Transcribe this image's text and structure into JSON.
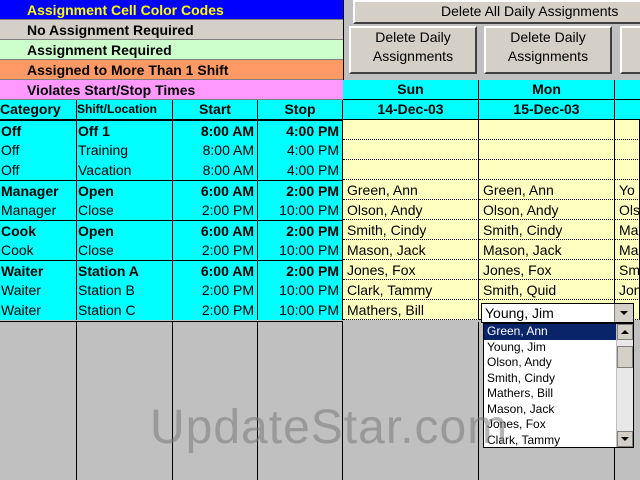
{
  "legend": {
    "title": "Assignment Cell Color Codes",
    "items": [
      {
        "label": "No Assignment Required",
        "color": "#d4d0c8"
      },
      {
        "label": "Assignment Required",
        "color": "#ccffcc"
      },
      {
        "label": "Assigned to More Than 1 Shift",
        "color": "#ff9966"
      },
      {
        "label": "Violates Start/Stop Times",
        "color": "#ff99ff"
      }
    ],
    "title_bg": "#0000ff",
    "title_color": "#ffff00"
  },
  "buttons": {
    "delete_all": "Delete All Daily Assignments",
    "delete_daily_line1": "Delete Daily",
    "delete_daily_line2": "Assignments"
  },
  "columns": {
    "category": "Category",
    "shift": "Shift/Location",
    "start": "Start",
    "stop": "Stop"
  },
  "days": [
    {
      "name": "Sun",
      "date": "14-Dec-03"
    },
    {
      "name": "Mon",
      "date": "15-Dec-03"
    }
  ],
  "rows": [
    {
      "category": "Off",
      "shift": "Off 1",
      "start": "8:00 AM",
      "stop": "4:00 PM",
      "bold": true,
      "sun": "",
      "mon": "",
      "tue": ""
    },
    {
      "category": "Off",
      "shift": "Training",
      "start": "8:00 AM",
      "stop": "4:00 PM",
      "bold": false,
      "sun": "",
      "mon": "",
      "tue": ""
    },
    {
      "category": "Off",
      "shift": "Vacation",
      "start": "8:00 AM",
      "stop": "4:00 PM",
      "bold": false,
      "sun": "",
      "mon": "",
      "tue": ""
    },
    {
      "category": "Manager",
      "shift": "Open",
      "start": "6:00 AM",
      "stop": "2:00 PM",
      "bold": true,
      "sun": "Green, Ann",
      "mon": "Green, Ann",
      "tue": "Yo"
    },
    {
      "category": "Manager",
      "shift": "Close",
      "start": "2:00 PM",
      "stop": "10:00 PM",
      "bold": false,
      "sun": "Olson, Andy",
      "mon": "Olson, Andy",
      "tue": "Ols"
    },
    {
      "category": "Cook",
      "shift": "Open",
      "start": "6:00 AM",
      "stop": "2:00 PM",
      "bold": true,
      "sun": "Smith, Cindy",
      "mon": "Smith, Cindy",
      "tue": "Ma"
    },
    {
      "category": "Cook",
      "shift": "Close",
      "start": "2:00 PM",
      "stop": "10:00 PM",
      "bold": false,
      "sun": "Mason, Jack",
      "mon": "Mason, Jack",
      "tue": "Ma"
    },
    {
      "category": "Waiter",
      "shift": "Station A",
      "start": "6:00 AM",
      "stop": "2:00 PM",
      "bold": true,
      "sun": "Jones, Fox",
      "mon": "Jones, Fox",
      "tue": "Sm"
    },
    {
      "category": "Waiter",
      "shift": "Station B",
      "start": "2:00 PM",
      "stop": "10:00 PM",
      "bold": false,
      "sun": "Clark, Tammy",
      "mon": "Smith, Quid",
      "tue": "Jon"
    },
    {
      "category": "Waiter",
      "shift": "Station C",
      "start": "2:00 PM",
      "stop": "10:00 PM",
      "bold": false,
      "sun": "Mathers, Bill",
      "mon": "Young, Jim",
      "tue": ""
    }
  ],
  "dropdown": {
    "current_value": "Young, Jim",
    "options": [
      "Green, Ann",
      "Young, Jim",
      "Olson, Andy",
      "Smith, Cindy",
      "Mathers, Bill",
      "Mason, Jack",
      "Jones, Fox",
      "Clark, Tammy"
    ],
    "selected_index": 0
  },
  "watermark": "UpdateStar.com"
}
